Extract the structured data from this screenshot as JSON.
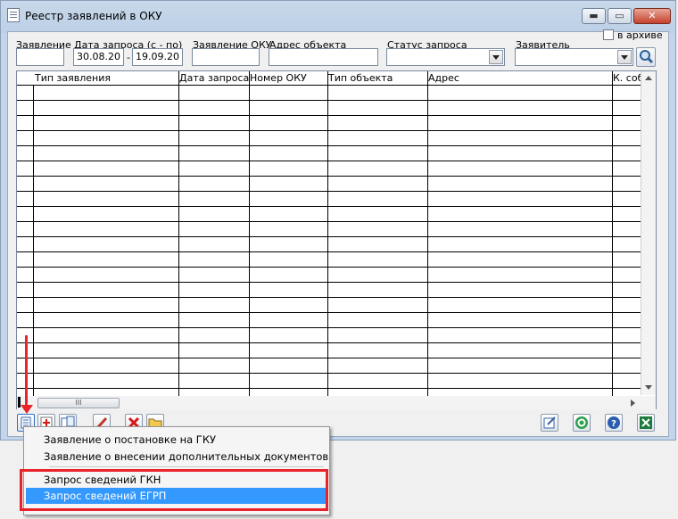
{
  "window": {
    "title": "Реестр заявлений в ОКУ",
    "min_glyph": "▬",
    "max_glyph": "▭",
    "close_glyph": "✕"
  },
  "filters": {
    "application_label": "Заявление",
    "request_date_label": "Дата запроса (с - по)",
    "date_from": "30.08.20",
    "date_sep": "-",
    "date_to": "19.09.20",
    "oku_application_label": "Заявление ОКУ",
    "object_address_label": "Адрес объекта",
    "request_status_label": "Статус запроса",
    "applicant_label": "Заявитель",
    "archive_label": "в архиве"
  },
  "grid": {
    "columns": [
      "Тип заявления",
      "Дата запроса",
      "Номер ОКУ",
      "Тип объекта",
      "Адрес",
      "К. соб"
    ],
    "hscroll_thumb": "III"
  },
  "toolbar": {
    "icons": [
      "list-icon",
      "add-icon",
      "documents-icon",
      "edit-pencil-icon",
      "delete-icon",
      "folder-icon",
      "open-icon",
      "refresh-icon",
      "help-icon",
      "excel-icon"
    ]
  },
  "menu": {
    "items": [
      "Заявление о постановке на ГКУ",
      "Заявление о внесении дополнительных документов",
      "Запрос сведений ГКН",
      "Запрос сведений ЕГРП"
    ],
    "highlighted_index": 3
  },
  "colors": {
    "highlight": "#3399ff",
    "annotation_red": "#e8232a"
  }
}
